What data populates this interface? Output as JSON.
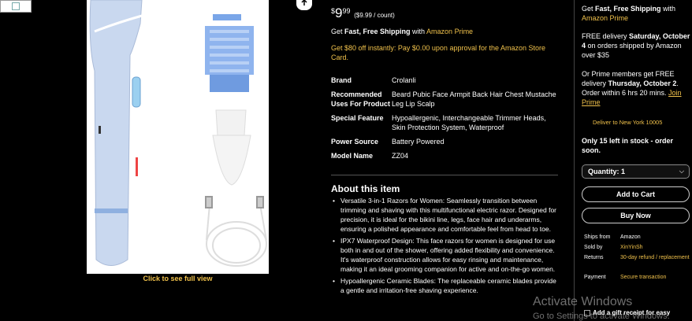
{
  "gallery": {
    "caption": "Click to see full view"
  },
  "price": {
    "currency": "$",
    "dollars": "9",
    "cents": "99",
    "per_unit": "($9.99 / count)"
  },
  "shipping": {
    "prefix": "Get ",
    "fast": "Fast, Free Shipping",
    "with": " with ",
    "prime": "Amazon Prime"
  },
  "offer": "Get $80 off instantly: Pay $0.00 upon approval for the Amazon Store Card.",
  "specs": [
    {
      "key": "Brand",
      "value": "Crolanli"
    },
    {
      "key": "Recommended Uses For Product",
      "value": "Beard Pubic Face Armpit Back Hair Chest Mustache Leg Lip Scalp"
    },
    {
      "key": "Special Feature",
      "value": "Hypoallergenic, Interchangeable Trimmer Heads, Skin Protection System, Waterproof"
    },
    {
      "key": "Power Source",
      "value": "Battery Powered"
    },
    {
      "key": "Model Name",
      "value": "ZZ04"
    }
  ],
  "about": {
    "title": "About this item",
    "bullets": [
      "Versatile 3-in-1 Razors for Women: Seamlessly transition between trimming and shaving with this multifunctional electric razor. Designed for precision, it is ideal for the bikini line, legs, face hair and underarms, ensuring a polished appearance and comfortable feel from head to toe.",
      "IPX7 Waterproof Design: This face razors for women is designed for use both in and out of the shower, offering added flexibility and convenience. It's waterproof construction allows for easy rinsing and maintenance, making it an ideal grooming companion for active and on-the-go women.",
      "Hypoallergenic Ceramic Blades: The replaceable ceramic blades provide a gentle and irritation-free shaving experience."
    ]
  },
  "buybox": {
    "ship_prefix": "Get ",
    "ship_fast": "Fast, Free Shipping",
    "ship_with": " with ",
    "ship_prime": "Amazon Prime",
    "free_delivery_prefix": "FREE delivery ",
    "free_delivery_date": "Saturday, October 4",
    "free_delivery_suffix": " on orders shipped by Amazon over $35",
    "prime_prefix": "Or Prime members get FREE delivery ",
    "prime_date": "Thursday, October 2",
    "prime_suffix": ". Order within 6 hrs 20 mins. ",
    "join_prime": "Join Prime",
    "deliver_to": "Deliver to New York 10005",
    "stock": "Only 15 left in stock - order soon.",
    "quantity": "Quantity: 1",
    "add_to_cart": "Add to Cart",
    "buy_now": "Buy Now",
    "details": [
      {
        "key": "Ships from",
        "value": "Amazon",
        "highlight": false
      },
      {
        "key": "Sold by",
        "value": "XinYinSh",
        "highlight": true
      },
      {
        "key": "Returns",
        "value": "30-day refund / replacement",
        "highlight": true
      },
      {
        "key": "Payment",
        "value": "Secure transaction",
        "highlight": true
      }
    ],
    "gift": "Add a gift receipt for easy"
  },
  "watermark": {
    "line1": "Activate Windows",
    "line2": "Go to Settings to activate Windows."
  },
  "colors": {
    "background": "#000000",
    "accent": "#f0c14b",
    "product": "#c9d8ef"
  }
}
